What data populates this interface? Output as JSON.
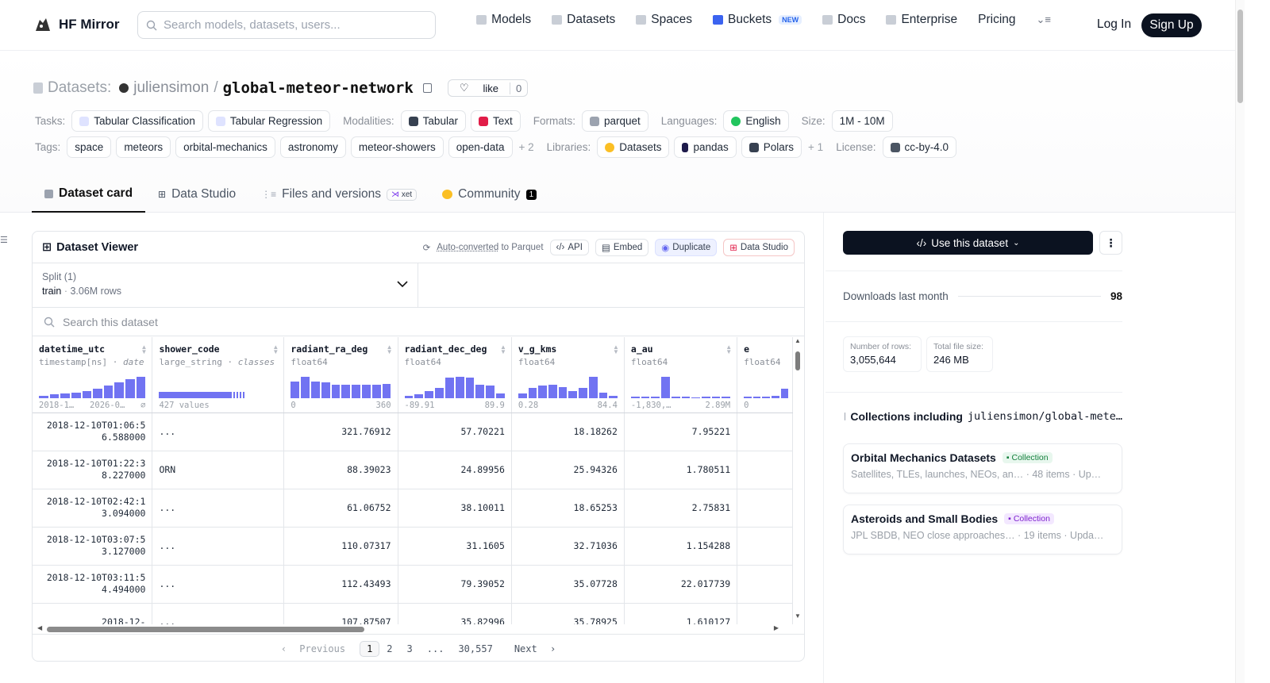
{
  "app": {
    "name": "HF Mirror"
  },
  "search": {
    "placeholder": "Search models, datasets, users..."
  },
  "nav": {
    "items": [
      "Models",
      "Datasets",
      "Spaces",
      "Buckets",
      "Docs",
      "Enterprise",
      "Pricing"
    ],
    "buckets_badge": "NEW",
    "login": "Log In",
    "signup": "Sign Up"
  },
  "dataset": {
    "section": "Datasets:",
    "owner": "juliensimon",
    "sep": "/",
    "name": "global-meteor-network",
    "like_label": "like",
    "like_count": "0"
  },
  "meta": {
    "tasks_label": "Tasks:",
    "tasks": [
      "Tabular Classification",
      "Tabular Regression"
    ],
    "modalities_label": "Modalities:",
    "modalities": [
      "Tabular",
      "Text"
    ],
    "formats_label": "Formats:",
    "formats": [
      "parquet"
    ],
    "languages_label": "Languages:",
    "languages": [
      "English"
    ],
    "size_label": "Size:",
    "size": "1M - 10M",
    "tags_label": "Tags:",
    "tags": [
      "space",
      "meteors",
      "orbital-mechanics",
      "astronomy",
      "meteor-showers",
      "open-data"
    ],
    "tags_more": "+ 2",
    "libraries_label": "Libraries:",
    "libraries": [
      "Datasets",
      "pandas",
      "Polars"
    ],
    "libraries_more": "+ 1",
    "license_label": "License:",
    "license": "cc-by-4.0"
  },
  "tabs": {
    "card": "Dataset card",
    "studio": "Data Studio",
    "files": "Files and versions",
    "xet": "xet",
    "community": "Community",
    "community_count": "1"
  },
  "viewer": {
    "title": "Dataset Viewer",
    "auto_converted": "Auto-converted",
    "to_parquet": "to Parquet",
    "api": "API",
    "embed": "Embed",
    "duplicate": "Duplicate",
    "data_studio": "Data Studio",
    "split_label": "Split (1)",
    "split_name": "train",
    "split_rows": "3.06M rows",
    "search_placeholder": "Search this dataset",
    "columns": [
      {
        "name": "datetime_utc",
        "type": "timestamp[ns]",
        "kind": "date",
        "min": "2018-1…",
        "max": "2026-0…",
        "extra": "⌀",
        "hist": [
          0.1,
          0.15,
          0.2,
          0.25,
          0.3,
          0.4,
          0.55,
          0.7,
          0.85,
          0.95
        ]
      },
      {
        "name": "shower_code",
        "type": "large_string",
        "kind": "classes",
        "min": "427 values",
        "max": "",
        "extra": "",
        "hist": []
      },
      {
        "name": "radiant_ra_deg",
        "type": "float64",
        "kind": "",
        "min": "0",
        "max": "360",
        "extra": "",
        "hist": [
          0.75,
          0.95,
          0.75,
          0.7,
          0.6,
          0.6,
          0.58,
          0.6,
          0.58,
          0.62
        ]
      },
      {
        "name": "radiant_dec_deg",
        "type": "float64",
        "kind": "",
        "min": "-89.91",
        "max": "89.9",
        "extra": "",
        "hist": [
          0.1,
          0.15,
          0.3,
          0.45,
          0.9,
          0.95,
          0.9,
          0.6,
          0.55,
          0.2
        ]
      },
      {
        "name": "v_g_kms",
        "type": "float64",
        "kind": "",
        "min": "0.28",
        "max": "84.4",
        "extra": "",
        "hist": [
          0.2,
          0.45,
          0.55,
          0.6,
          0.5,
          0.3,
          0.45,
          0.95,
          0.25,
          0.08
        ]
      },
      {
        "name": "a_au",
        "type": "float64",
        "kind": "",
        "min": "-1,830,…",
        "max": "2.89M",
        "extra": "",
        "hist": [
          0.04,
          0.04,
          0.04,
          0.95,
          0.04,
          0.04,
          0.02,
          0.04,
          0.04,
          0.04
        ]
      },
      {
        "name": "e",
        "type": "float64",
        "kind": "",
        "min": "0",
        "max": "",
        "extra": "",
        "hist": [
          0.05,
          0.05,
          0.05,
          0.1,
          0.4
        ]
      }
    ],
    "rows": [
      [
        "2018-12-10T01:06:56.588000",
        "...",
        "321.76912",
        "57.70221",
        "18.18262",
        "7.95221",
        ""
      ],
      [
        "2018-12-10T01:22:38.227000",
        "ORN",
        "88.39023",
        "24.89956",
        "25.94326",
        "1.780511",
        ""
      ],
      [
        "2018-12-10T02:42:13.094000",
        "...",
        "61.06752",
        "38.10011",
        "18.65253",
        "2.75831",
        ""
      ],
      [
        "2018-12-10T03:07:53.127000",
        "...",
        "110.07317",
        "31.1605",
        "32.71036",
        "1.154288",
        ""
      ],
      [
        "2018-12-10T03:11:54.494000",
        "...",
        "112.43493",
        "79.39052",
        "35.07728",
        "22.017739",
        ""
      ],
      [
        "2018-12-",
        "...",
        "107.87507",
        "35.82996",
        "35.78925",
        "1.610127",
        ""
      ]
    ],
    "pager": {
      "prev": "Previous",
      "pages": [
        "1",
        "2",
        "3",
        "...",
        "30,557"
      ],
      "next": "Next"
    }
  },
  "sidebar": {
    "use_label": "Use this dataset",
    "downloads_label": "Downloads last month",
    "downloads": "98",
    "rows_label": "Number of rows:",
    "rows": "3,055,644",
    "size_label": "Total file size:",
    "size": "246 MB",
    "collections_label": "Collections including",
    "collections_repo": "juliensimon/global-mete…",
    "collections": [
      {
        "title": "Orbital Mechanics Datasets",
        "tag": "Collection",
        "desc": "Satellites, TLEs, launches, NEOs, an…",
        "items": "48 items",
        "updated": "Up…"
      },
      {
        "title": "Asteroids and Small Bodies",
        "tag": "Collection",
        "desc": "JPL SBDB, NEO close approaches…",
        "items": "19 items",
        "updated": "Upda…"
      }
    ]
  },
  "colors": {
    "accent": "#7173f2",
    "dark": "#0b1220"
  }
}
